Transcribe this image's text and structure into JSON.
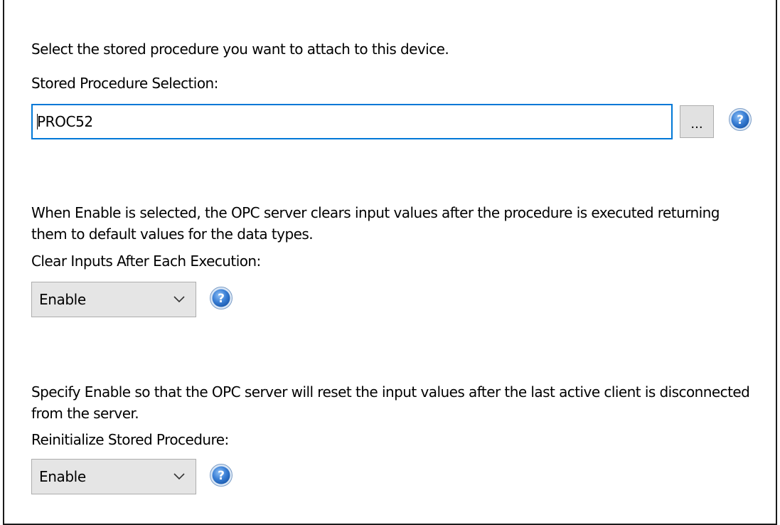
{
  "procedure_section": {
    "description": "Select the stored procedure you want to attach to this device.",
    "label": "Stored Procedure Selection:",
    "value": "PROC52",
    "browse_label": "..."
  },
  "clear_inputs_section": {
    "description": "When Enable is selected, the OPC server clears input values after the procedure is executed returning them to default values for the data types.",
    "label": "Clear Inputs After Each Execution:",
    "selected": "Enable"
  },
  "reinitialize_section": {
    "description": "Specify Enable so that the OPC server will reset the input values after the last active client is disconnected from the server.",
    "label": "Reinitialize Stored Procedure:",
    "selected": "Enable"
  },
  "colors": {
    "focus_border": "#0078d7",
    "help_icon": "#3a7fd5",
    "dropdown_bg": "#e5e5e5"
  },
  "icons": [
    "help-icon",
    "chevron-down-icon"
  ]
}
